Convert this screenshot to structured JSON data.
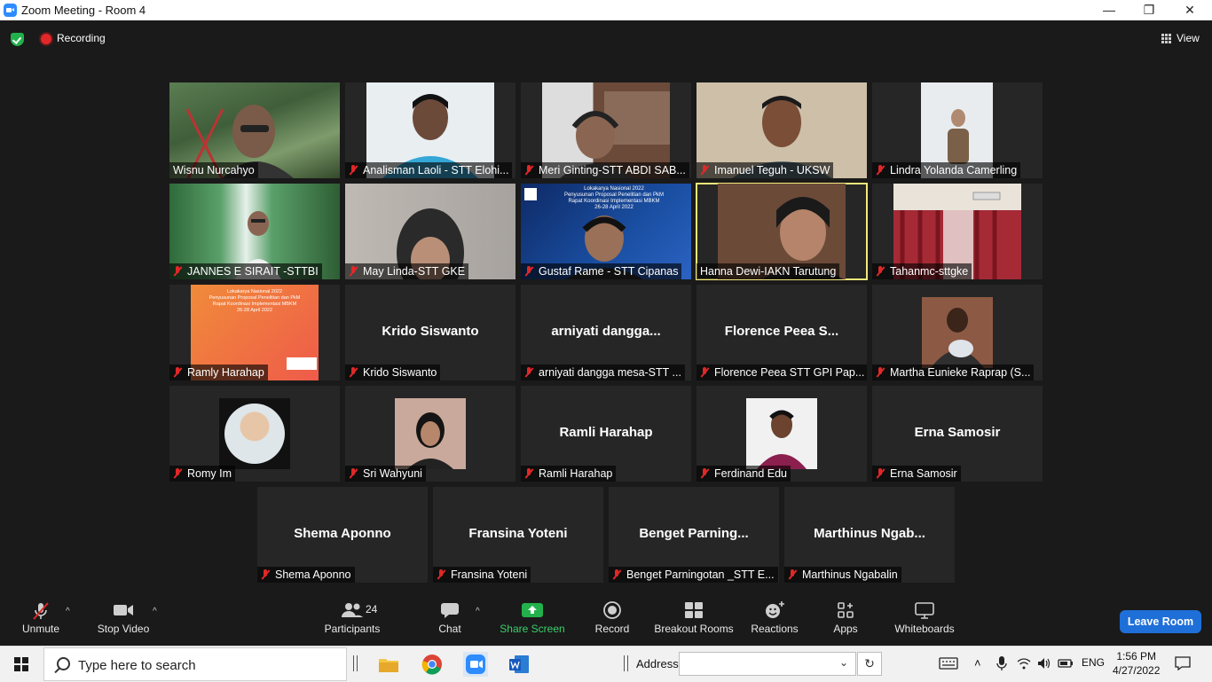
{
  "window": {
    "title": "Zoom Meeting - Room 4"
  },
  "topbar": {
    "recording_label": "Recording",
    "view_label": "View"
  },
  "participants": [
    {
      "name": "Wisnu Nurcahyo",
      "display": "",
      "muted": false,
      "video": "scene-bridge"
    },
    {
      "name": "Analisman Laoli - STT Elohi...",
      "display": "",
      "muted": true,
      "video": "person-blue"
    },
    {
      "name": "Meri Ginting-STT ABDI SAB...",
      "display": "",
      "muted": true,
      "video": "person-room"
    },
    {
      "name": "Imanuel Teguh - UKSW",
      "display": "",
      "muted": true,
      "video": "person-wall"
    },
    {
      "name": "Lindra Yolanda Camerling",
      "display": "",
      "muted": true,
      "video": "person-small"
    },
    {
      "name": "JANNES E SIRAIT -STTBI",
      "display": "",
      "muted": true,
      "video": "scene-waterfall"
    },
    {
      "name": "May Linda-STT GKE",
      "display": "",
      "muted": true,
      "video": "person-gray"
    },
    {
      "name": "Gustaf Rame - STT Cipanas",
      "display": "",
      "muted": true,
      "video": "banner-blue"
    },
    {
      "name": "Hanna Dewi-IAKN Tarutung",
      "display": "",
      "muted": false,
      "video": "person-woman",
      "active": true
    },
    {
      "name": "Tahanmc-sttgke",
      "display": "",
      "muted": true,
      "video": "scene-curtain"
    },
    {
      "name": "Ramly Harahap",
      "display": "",
      "muted": true,
      "video": "banner-orange"
    },
    {
      "name": "Krido Siswanto",
      "display": "Krido Siswanto",
      "muted": true,
      "video": ""
    },
    {
      "name": "arniyati dangga mesa-STT ...",
      "display": "arniyati  dangga...",
      "muted": true,
      "video": ""
    },
    {
      "name": "Florence Peea STT GPI Pap...",
      "display": "Florence  Peea  S...",
      "muted": true,
      "video": ""
    },
    {
      "name": "Martha Eunieke Raprap (S...",
      "display": "",
      "muted": true,
      "video": "photo-family"
    },
    {
      "name": "Romy Im",
      "display": "",
      "muted": true,
      "video": "photo-circle"
    },
    {
      "name": "Sri Wahyuni",
      "display": "",
      "muted": true,
      "video": "photo-woman"
    },
    {
      "name": "Ramli Harahap",
      "display": "Ramli Harahap",
      "muted": true,
      "video": ""
    },
    {
      "name": "Ferdinand Edu",
      "display": "",
      "muted": true,
      "video": "photo-man"
    },
    {
      "name": "Erna Samosir",
      "display": "Erna Samosir",
      "muted": true,
      "video": ""
    },
    {
      "name": "Shema Aponno",
      "display": "Shema Aponno",
      "muted": true,
      "video": ""
    },
    {
      "name": "Fransina Yoteni",
      "display": "Fransina Yoteni",
      "muted": true,
      "video": ""
    },
    {
      "name": "Benget Parningotan _STT E...",
      "display": "Benget  Parning...",
      "muted": true,
      "video": ""
    },
    {
      "name": "Marthinus Ngabalin",
      "display": "Marthinus  Ngab...",
      "muted": true,
      "video": ""
    }
  ],
  "banner_text": {
    "blue": [
      "Lokakarya Nasional 2022",
      "Penyusunan Proposal Penelitian dan PkM",
      "Rapat Koordinasi Implementasi MBKM",
      "26-28 April 2022"
    ],
    "orange": [
      "Lokakarya Nasional 2022",
      "Penyusunan Proposal Penelitian dan PkM",
      "Rapat Koordinasi Implementasi MBKM",
      "26-28 April 2022"
    ]
  },
  "toolbar": {
    "unmute": "Unmute",
    "stop_video": "Stop Video",
    "participants": "Participants",
    "participants_count": "24",
    "chat": "Chat",
    "share_screen": "Share Screen",
    "record": "Record",
    "breakout_rooms": "Breakout Rooms",
    "reactions": "Reactions",
    "apps": "Apps",
    "whiteboards": "Whiteboards",
    "leave_room": "Leave Room"
  },
  "taskbar": {
    "search_placeholder": "Type here to search",
    "address_label": "Address",
    "language": "ENG",
    "time": "1:56 PM",
    "date": "4/27/2022"
  },
  "colors": {
    "active_speaker": "#f2e87a",
    "share_green": "#22b14c",
    "leave_blue": "#1f6fd8",
    "muted_red": "#e02828"
  }
}
